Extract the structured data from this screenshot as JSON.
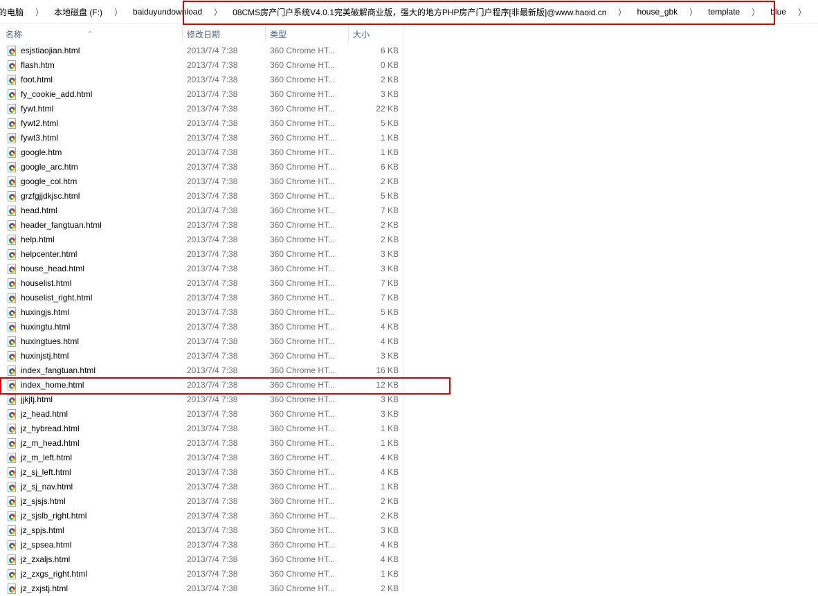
{
  "breadcrumb": [
    "的电脑",
    "本地磁盘 (F:)",
    "baiduyundownload",
    "08CMS房产门户系统V4.0.1完美破解商业版，强大的地方PHP房产门户程序[非最新版]@www.haoid.cn",
    "house_gbk",
    "template",
    "blue"
  ],
  "columns": {
    "name": "名称",
    "date": "修改日期",
    "type": "类型",
    "size": "大小"
  },
  "files": [
    {
      "name": "esjstiaojian.html",
      "date": "2013/7/4 7:38",
      "type": "360 Chrome HT...",
      "size": "6 KB"
    },
    {
      "name": "flash.htm",
      "date": "2013/7/4 7:38",
      "type": "360 Chrome HT...",
      "size": "0 KB"
    },
    {
      "name": "foot.html",
      "date": "2013/7/4 7:38",
      "type": "360 Chrome HT...",
      "size": "2 KB"
    },
    {
      "name": "fy_cookie_add.html",
      "date": "2013/7/4 7:38",
      "type": "360 Chrome HT...",
      "size": "3 KB"
    },
    {
      "name": "fywt.html",
      "date": "2013/7/4 7:38",
      "type": "360 Chrome HT...",
      "size": "22 KB"
    },
    {
      "name": "fywt2.html",
      "date": "2013/7/4 7:38",
      "type": "360 Chrome HT...",
      "size": "5 KB"
    },
    {
      "name": "fywt3.html",
      "date": "2013/7/4 7:38",
      "type": "360 Chrome HT...",
      "size": "1 KB"
    },
    {
      "name": "google.htm",
      "date": "2013/7/4 7:38",
      "type": "360 Chrome HT...",
      "size": "1 KB"
    },
    {
      "name": "google_arc.htm",
      "date": "2013/7/4 7:38",
      "type": "360 Chrome HT...",
      "size": "6 KB"
    },
    {
      "name": "google_col.htm",
      "date": "2013/7/4 7:38",
      "type": "360 Chrome HT...",
      "size": "2 KB"
    },
    {
      "name": "grzfgjjdkjsc.html",
      "date": "2013/7/4 7:38",
      "type": "360 Chrome HT...",
      "size": "5 KB"
    },
    {
      "name": "head.html",
      "date": "2013/7/4 7:38",
      "type": "360 Chrome HT...",
      "size": "7 KB"
    },
    {
      "name": "header_fangtuan.html",
      "date": "2013/7/4 7:38",
      "type": "360 Chrome HT...",
      "size": "2 KB"
    },
    {
      "name": "help.html",
      "date": "2013/7/4 7:38",
      "type": "360 Chrome HT...",
      "size": "2 KB"
    },
    {
      "name": "helpcenter.html",
      "date": "2013/7/4 7:38",
      "type": "360 Chrome HT...",
      "size": "3 KB"
    },
    {
      "name": "house_head.html",
      "date": "2013/7/4 7:38",
      "type": "360 Chrome HT...",
      "size": "3 KB"
    },
    {
      "name": "houselist.html",
      "date": "2013/7/4 7:38",
      "type": "360 Chrome HT...",
      "size": "7 KB"
    },
    {
      "name": "houselist_right.html",
      "date": "2013/7/4 7:38",
      "type": "360 Chrome HT...",
      "size": "7 KB"
    },
    {
      "name": "huxingjs.html",
      "date": "2013/7/4 7:38",
      "type": "360 Chrome HT...",
      "size": "5 KB"
    },
    {
      "name": "huxingtu.html",
      "date": "2013/7/4 7:38",
      "type": "360 Chrome HT...",
      "size": "4 KB"
    },
    {
      "name": "huxingtues.html",
      "date": "2013/7/4 7:38",
      "type": "360 Chrome HT...",
      "size": "4 KB"
    },
    {
      "name": "huxinjstj.html",
      "date": "2013/7/4 7:38",
      "type": "360 Chrome HT...",
      "size": "3 KB"
    },
    {
      "name": "index_fangtuan.html",
      "date": "2013/7/4 7:38",
      "type": "360 Chrome HT...",
      "size": "16 KB"
    },
    {
      "name": "index_home.html",
      "date": "2013/7/4 7:38",
      "type": "360 Chrome HT...",
      "size": "12 KB"
    },
    {
      "name": "jjkjtj.html",
      "date": "2013/7/4 7:38",
      "type": "360 Chrome HT...",
      "size": "3 KB"
    },
    {
      "name": "jz_head.html",
      "date": "2013/7/4 7:38",
      "type": "360 Chrome HT...",
      "size": "3 KB"
    },
    {
      "name": "jz_hybread.html",
      "date": "2013/7/4 7:38",
      "type": "360 Chrome HT...",
      "size": "1 KB"
    },
    {
      "name": "jz_m_head.html",
      "date": "2013/7/4 7:38",
      "type": "360 Chrome HT...",
      "size": "1 KB"
    },
    {
      "name": "jz_m_left.html",
      "date": "2013/7/4 7:38",
      "type": "360 Chrome HT...",
      "size": "4 KB"
    },
    {
      "name": "jz_sj_left.html",
      "date": "2013/7/4 7:38",
      "type": "360 Chrome HT...",
      "size": "4 KB"
    },
    {
      "name": "jz_sj_nav.html",
      "date": "2013/7/4 7:38",
      "type": "360 Chrome HT...",
      "size": "1 KB"
    },
    {
      "name": "jz_sjsjs.html",
      "date": "2013/7/4 7:38",
      "type": "360 Chrome HT...",
      "size": "2 KB"
    },
    {
      "name": "jz_sjslb_right.html",
      "date": "2013/7/4 7:38",
      "type": "360 Chrome HT...",
      "size": "2 KB"
    },
    {
      "name": "jz_spjs.html",
      "date": "2013/7/4 7:38",
      "type": "360 Chrome HT...",
      "size": "3 KB"
    },
    {
      "name": "jz_spsea.html",
      "date": "2013/7/4 7:38",
      "type": "360 Chrome HT...",
      "size": "4 KB"
    },
    {
      "name": "jz_zxaljs.html",
      "date": "2013/7/4 7:38",
      "type": "360 Chrome HT...",
      "size": "4 KB"
    },
    {
      "name": "jz_zxgs_right.html",
      "date": "2013/7/4 7:38",
      "type": "360 Chrome HT...",
      "size": "1 KB"
    },
    {
      "name": "jz_zxjstj.html",
      "date": "2013/7/4 7:38",
      "type": "360 Chrome HT...",
      "size": "2 KB"
    }
  ]
}
